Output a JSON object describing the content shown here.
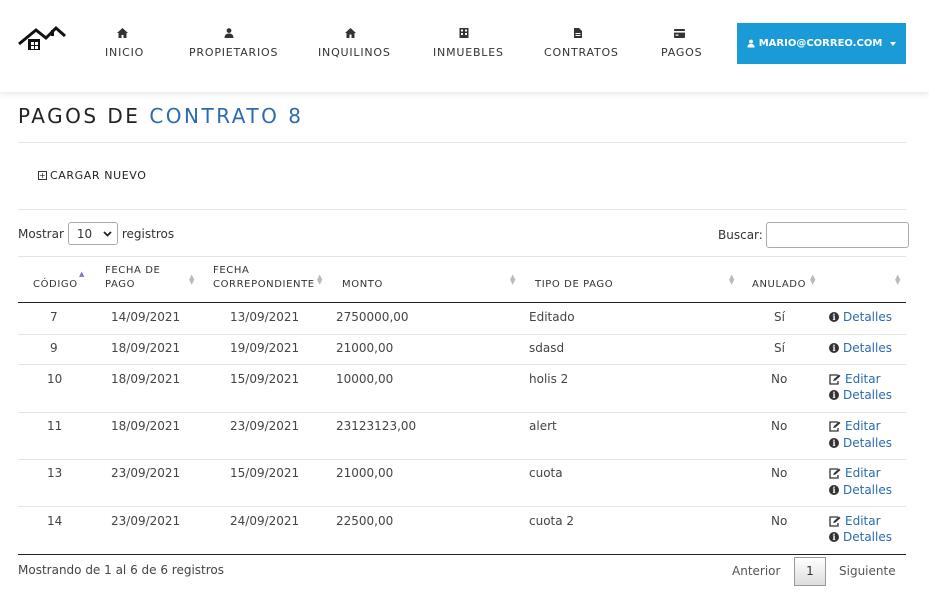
{
  "nav": {
    "items": [
      {
        "label": "INICIO",
        "icon": "home-icon"
      },
      {
        "label": "PROPIETARIOS",
        "icon": "user-icon"
      },
      {
        "label": "INQUILINOS",
        "icon": "house-icon"
      },
      {
        "label": "INMUEBLES",
        "icon": "building-icon"
      },
      {
        "label": "CONTRATOS",
        "icon": "file-icon"
      },
      {
        "label": "PAGOS",
        "icon": "credit-card-icon"
      }
    ],
    "user": "MARIO@CORREO.COM",
    "accent": "#1a9bd7"
  },
  "page": {
    "title_prefix": "PAGOS DE ",
    "title_highlight": "CONTRATO 8",
    "title_color": "#2a6bb1"
  },
  "actions": {
    "new_label": "CARGAR NUEVO"
  },
  "controls": {
    "show_before": "Mostrar",
    "show_value": "10",
    "show_after": "registros",
    "search_label": "Buscar:",
    "search_value": ""
  },
  "table": {
    "columns": [
      {
        "l1": "",
        "l2": "CÓDIGO"
      },
      {
        "l1": "FECHA DE",
        "l2": "PAGO"
      },
      {
        "l1": "FECHA",
        "l2": "CORREPONDIENTE"
      },
      {
        "l1": "",
        "l2": "MONTO"
      },
      {
        "l1": "",
        "l2": "TIPO DE PAGO"
      },
      {
        "l1": "",
        "l2": "ANULADO"
      },
      {
        "l1": "",
        "l2": ""
      }
    ],
    "rows": [
      {
        "codigo": "7",
        "fecha_pago": "14/09/2021",
        "fecha_corr": "13/09/2021",
        "monto": "2750000,00",
        "tipo": "Editado",
        "anulado": "Sí",
        "editar": "",
        "detalles": "Detalles"
      },
      {
        "codigo": "9",
        "fecha_pago": "18/09/2021",
        "fecha_corr": "19/09/2021",
        "monto": "21000,00",
        "tipo": "sdasd",
        "anulado": "Sí",
        "editar": "",
        "detalles": "Detalles"
      },
      {
        "codigo": "10",
        "fecha_pago": "18/09/2021",
        "fecha_corr": "15/09/2021",
        "monto": "10000,00",
        "tipo": "holis 2",
        "anulado": "No",
        "editar": "Editar",
        "detalles": "Detalles"
      },
      {
        "codigo": "11",
        "fecha_pago": "18/09/2021",
        "fecha_corr": "23/09/2021",
        "monto": "23123123,00",
        "tipo": "alert",
        "anulado": "No",
        "editar": "Editar",
        "detalles": "Detalles"
      },
      {
        "codigo": "13",
        "fecha_pago": "23/09/2021",
        "fecha_corr": "15/09/2021",
        "monto": "21000,00",
        "tipo": "cuota",
        "anulado": "No",
        "editar": "Editar",
        "detalles": "Detalles"
      },
      {
        "codigo": "14",
        "fecha_pago": "23/09/2021",
        "fecha_corr": "24/09/2021",
        "monto": "22500,00",
        "tipo": "cuota 2",
        "anulado": "No",
        "editar": "Editar",
        "detalles": "Detalles"
      }
    ]
  },
  "footer": {
    "info": "Mostrando de 1 al 6 de 6 registros",
    "prev": "Anterior",
    "page": "1",
    "next": "Siguiente"
  }
}
